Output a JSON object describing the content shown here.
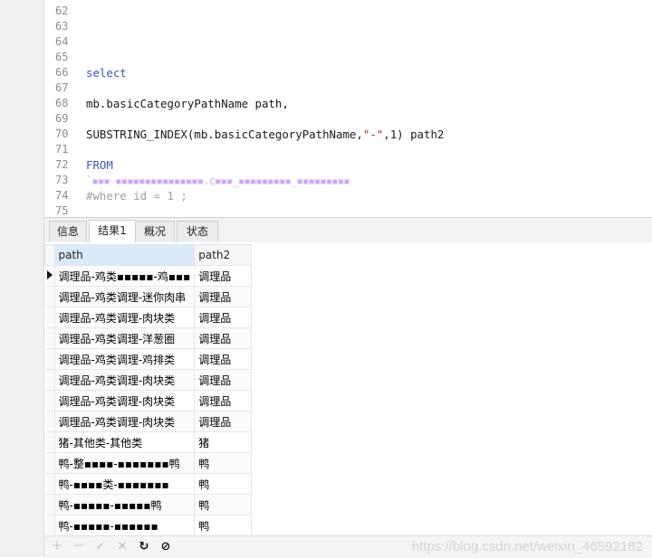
{
  "editor": {
    "lines": [
      {
        "num": "62",
        "text": ""
      },
      {
        "num": "63",
        "text": ""
      },
      {
        "num": "64",
        "text": ""
      },
      {
        "num": "65",
        "text": ""
      },
      {
        "num": "66",
        "text": "select"
      },
      {
        "num": "67",
        "text": ""
      },
      {
        "num": "68",
        "text": "mb.basicCategoryPathName path,"
      },
      {
        "num": "69",
        "text": ""
      },
      {
        "num": "70",
        "text": "SUBSTRING_INDEX(mb.basicCategoryPathName,\"-\",1) path2"
      },
      {
        "num": "71",
        "text": ""
      },
      {
        "num": "72",
        "text": "FROM"
      },
      {
        "num": "73",
        "text": "`▪▪▪ ▪▪▪▪▪▪▪▪▪▪▪▪▪▪▪.c▪▪▪_▪▪▪▪▪▪▪▪▪_▪▪▪▪▪▪▪▪▪"
      },
      {
        "num": "74",
        "text": "#where id = 1 ;"
      },
      {
        "num": "75",
        "text": ""
      }
    ]
  },
  "tabs": [
    "信息",
    "结果1",
    "概况",
    "状态"
  ],
  "grid": {
    "columns": [
      "path",
      "path2"
    ],
    "rows": [
      [
        "调理品-鸡类▪▪▪▪▪-鸡▪▪▪",
        "调理品"
      ],
      [
        "调理品-鸡类调理-迷你肉串",
        "调理品"
      ],
      [
        "调理品-鸡类调理-肉块类",
        "调理品"
      ],
      [
        "调理品-鸡类调理-洋葱圈",
        "调理品"
      ],
      [
        "调理品-鸡类调理-鸡排类",
        "调理品"
      ],
      [
        "调理品-鸡类调理-肉块类",
        "调理品"
      ],
      [
        "调理品-鸡类调理-肉块类",
        "调理品"
      ],
      [
        "调理品-鸡类调理-肉块类",
        "调理品"
      ],
      [
        "猪-其他类-其他类",
        "猪"
      ],
      [
        "鸭-整▪▪▪▪-▪▪▪▪▪▪▪鸭",
        "鸭"
      ],
      [
        "鸭-▪▪▪▪类-▪▪▪▪▪▪▪",
        "鸭"
      ],
      [
        "鸭-▪▪▪▪▪-▪▪▪▪▪鸭",
        "鸭"
      ],
      [
        "鸭-▪▪▪▪▪-▪▪▪▪▪▪",
        "鸭"
      ]
    ]
  },
  "toolbar": {
    "add_icon": "＋",
    "remove_icon": "－",
    "apply_icon": "✓",
    "cancel_icon": "✕",
    "refresh_icon": "↻",
    "stop_icon": "⊘",
    "watermark": "https://blog.csdn.net/weixin_46592182"
  }
}
